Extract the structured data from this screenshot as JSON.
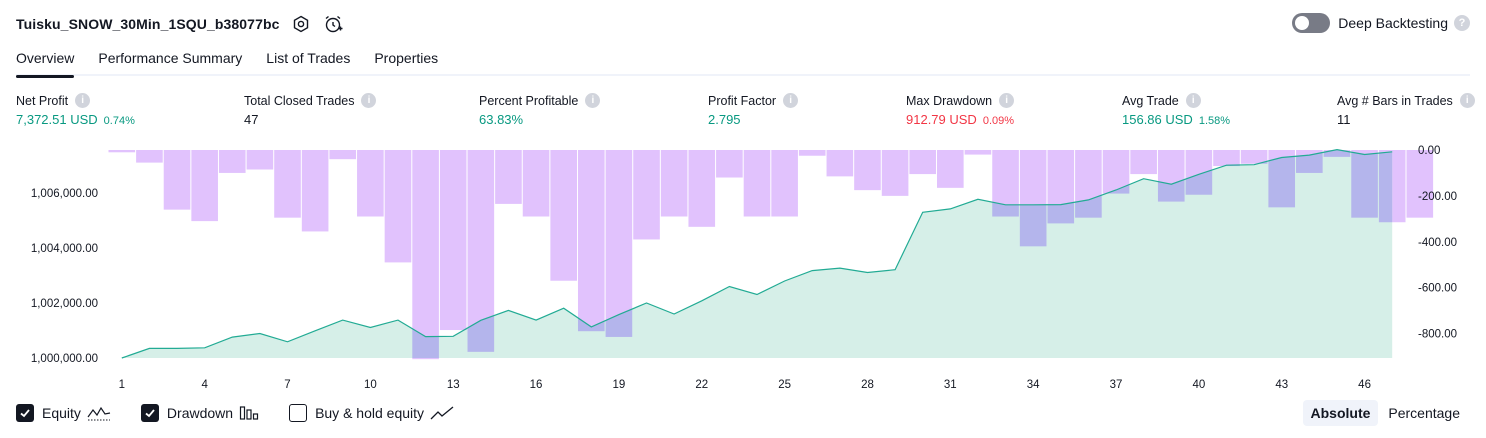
{
  "header": {
    "title": "Tuisku_SNOW_30Min_1SQU_b38077bc",
    "deep_backtesting_label": "Deep Backtesting",
    "help_glyph": "?"
  },
  "tabs": [
    {
      "label": "Overview",
      "active": true
    },
    {
      "label": "Performance Summary",
      "active": false
    },
    {
      "label": "List of Trades",
      "active": false
    },
    {
      "label": "Properties",
      "active": false
    }
  ],
  "metrics": [
    {
      "label": "Net Profit",
      "value": "7,372.51 USD",
      "pct": "0.74%",
      "color": "green"
    },
    {
      "label": "Total Closed Trades",
      "value": "47",
      "pct": "",
      "color": "neutral"
    },
    {
      "label": "Percent Profitable",
      "value": "63.83%",
      "pct": "",
      "color": "green"
    },
    {
      "label": "Profit Factor",
      "value": "2.795",
      "pct": "",
      "color": "green"
    },
    {
      "label": "Max Drawdown",
      "value": "912.79 USD",
      "pct": "0.09%",
      "color": "red"
    },
    {
      "label": "Avg Trade",
      "value": "156.86 USD",
      "pct": "1.58%",
      "color": "green"
    },
    {
      "label": "Avg # Bars in Trades",
      "value": "11",
      "pct": "",
      "color": "neutral"
    }
  ],
  "chart_data": {
    "type": "area",
    "x_ticks": [
      "1",
      "4",
      "7",
      "10",
      "13",
      "16",
      "19",
      "22",
      "25",
      "28",
      "31",
      "34",
      "37",
      "40",
      "43",
      "46"
    ],
    "left_axis": {
      "ticks": [
        "1,006,000.00",
        "1,004,000.00",
        "1,002,000.00",
        "1,000,000.00"
      ],
      "tick_values": [
        1006000,
        1004000,
        1002000,
        1000000
      ]
    },
    "right_axis": {
      "ticks": [
        "0.00",
        "-200.00",
        "-400.00",
        "-600.00",
        "-800.00"
      ],
      "tick_values": [
        0,
        -200,
        -400,
        -600,
        -800
      ]
    },
    "series": [
      {
        "name": "Equity",
        "color": "#22ab94",
        "fill": "#d6efe8",
        "values": [
          1000000,
          1000350,
          1000350,
          1000370,
          1000760,
          1000890,
          1000590,
          1000990,
          1001380,
          1001110,
          1001380,
          1000780,
          1000790,
          1001370,
          1001730,
          1001380,
          1001810,
          1001130,
          1001580,
          1002000,
          1001600,
          1002080,
          1002600,
          1002310,
          1002800,
          1003180,
          1003270,
          1003110,
          1003210,
          1005300,
          1005420,
          1005770,
          1005570,
          1005570,
          1005580,
          1005750,
          1006110,
          1006520,
          1006320,
          1006680,
          1007010,
          1007030,
          1007290,
          1007380,
          1007580,
          1007400,
          1007500
        ]
      },
      {
        "name": "Drawdown",
        "color": "#e1c2fd",
        "overlap_color": "#b4b5ec",
        "values": [
          -10,
          -55,
          -260,
          -310,
          -100,
          -85,
          -295,
          -355,
          -40,
          -290,
          -490,
          -912,
          -785,
          -880,
          -235,
          -290,
          -570,
          -790,
          -815,
          -390,
          -290,
          -335,
          -120,
          -290,
          -290,
          -25,
          -115,
          -175,
          -200,
          -105,
          -165,
          -20,
          -290,
          -420,
          -320,
          -295,
          -190,
          -105,
          -225,
          -195,
          -70,
          -60,
          -250,
          -100,
          -30,
          -295,
          -315,
          -295
        ]
      }
    ]
  },
  "legend": [
    {
      "label": "Equity",
      "checked": true,
      "icon": "equity-line-icon"
    },
    {
      "label": "Drawdown",
      "checked": true,
      "icon": "drawdown-bars-icon"
    },
    {
      "label": "Buy & hold equity",
      "checked": false,
      "icon": "buy-hold-line-icon"
    }
  ],
  "view_toggle": {
    "absolute_label": "Absolute",
    "percentage_label": "Percentage",
    "selected": "Absolute"
  }
}
